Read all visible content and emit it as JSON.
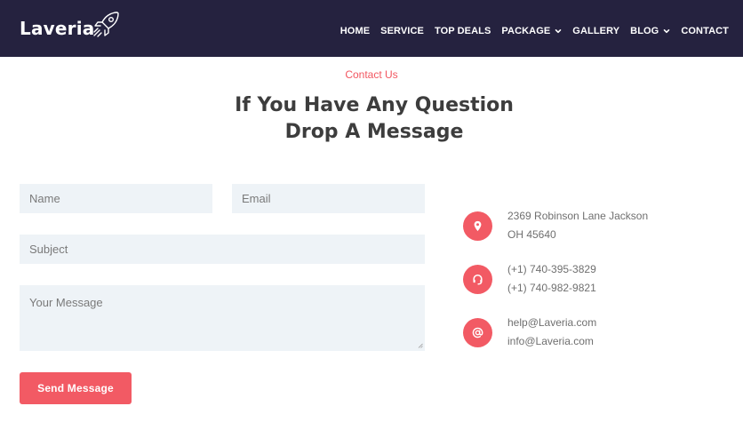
{
  "brand": {
    "name": "Laveria",
    "logo_icon": "rocket-icon"
  },
  "nav": {
    "items": [
      {
        "label": "HOME",
        "dropdown": false
      },
      {
        "label": "SERVICE",
        "dropdown": false
      },
      {
        "label": "TOP DEALS",
        "dropdown": false
      },
      {
        "label": "PACKAGE",
        "dropdown": true
      },
      {
        "label": "GALLERY",
        "dropdown": false
      },
      {
        "label": "BLOG",
        "dropdown": true
      },
      {
        "label": "CONTACT",
        "dropdown": false
      }
    ]
  },
  "section": {
    "eyebrow": "Contact Us",
    "title_line1": "If You Have Any Question",
    "title_line2": "Drop A Message"
  },
  "form": {
    "name_placeholder": "Name",
    "email_placeholder": "Email",
    "subject_placeholder": "Subject",
    "message_placeholder": "Your Message",
    "submit_label": "Send Message"
  },
  "contact": {
    "address": {
      "icon": "map-pin-icon",
      "line1": "2369 Robinson Lane Jackson",
      "line2": "OH 45640"
    },
    "phone": {
      "icon": "headset-icon",
      "line1": "(+1) 740-395-3829",
      "line2": "(+1) 740-982-9821"
    },
    "email": {
      "icon": "at-sign-icon",
      "line1": "help@Laveria.com",
      "line2": "info@Laveria.com"
    }
  },
  "colors": {
    "header_bg": "#25223f",
    "accent": "#f25a64",
    "field_bg": "#eef3f7",
    "heading_text": "#3d3d3d"
  }
}
